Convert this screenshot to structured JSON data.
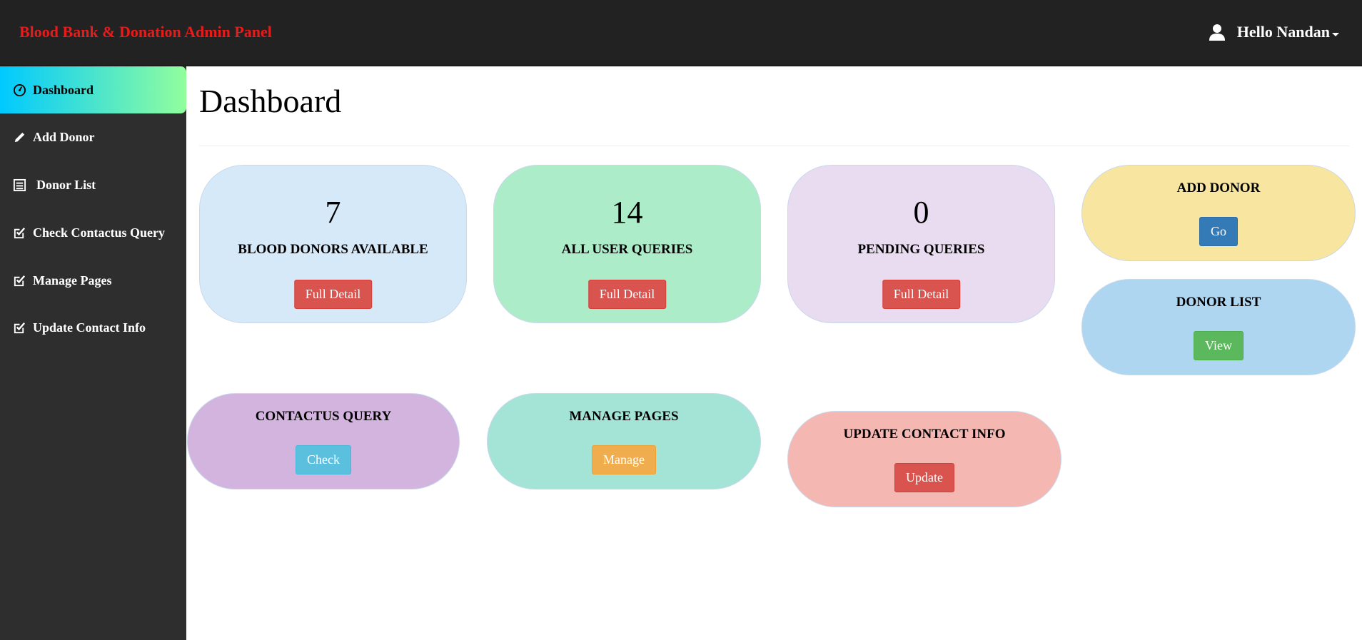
{
  "header": {
    "brand": "Blood Bank & Donation Admin Panel",
    "user_greeting": "Hello Nandan"
  },
  "sidebar": {
    "items": [
      {
        "label": "Dashboard",
        "icon": "dashboard-icon",
        "active": true
      },
      {
        "label": "Add Donor",
        "icon": "pencil-icon"
      },
      {
        "label": "Donor List",
        "icon": "list-icon"
      },
      {
        "label": "Check Contactus Query",
        "icon": "check-square-icon"
      },
      {
        "label": "Manage Pages",
        "icon": "check-square-icon"
      },
      {
        "label": "Update Contact Info",
        "icon": "check-square-icon"
      }
    ]
  },
  "main": {
    "title": "Dashboard",
    "stats": [
      {
        "value": "7",
        "label": "BLOOD DONORS AVAILABLE",
        "button": "Full Detail",
        "color": "#d6e9f8"
      },
      {
        "value": "14",
        "label": "ALL USER QUERIES",
        "button": "Full Detail",
        "color": "#acecc8"
      },
      {
        "value": "0",
        "label": "PENDING QUERIES",
        "button": "Full Detail",
        "color": "#e9dbf0"
      }
    ],
    "actions": [
      {
        "label": "ADD DONOR",
        "button": "Go",
        "color": "#f8e6a0"
      },
      {
        "label": "DONOR LIST",
        "button": "View",
        "color": "#aed6f1"
      },
      {
        "label": "CONTACTUS QUERY",
        "button": "Check",
        "color": "#d2b4de"
      },
      {
        "label": "MANAGE PAGES",
        "button": "Manage",
        "color": "#a3e4d7"
      },
      {
        "label": "UPDATE CONTACT INFO",
        "button": "Update",
        "color": "#f5b7b1"
      }
    ]
  },
  "colors": {
    "brand_red": "#e81b1b",
    "topbar": "#222222",
    "sidebar": "#2e2e2e",
    "active_gradient_start": "#00c9ff",
    "active_gradient_end": "#92fe9d"
  }
}
